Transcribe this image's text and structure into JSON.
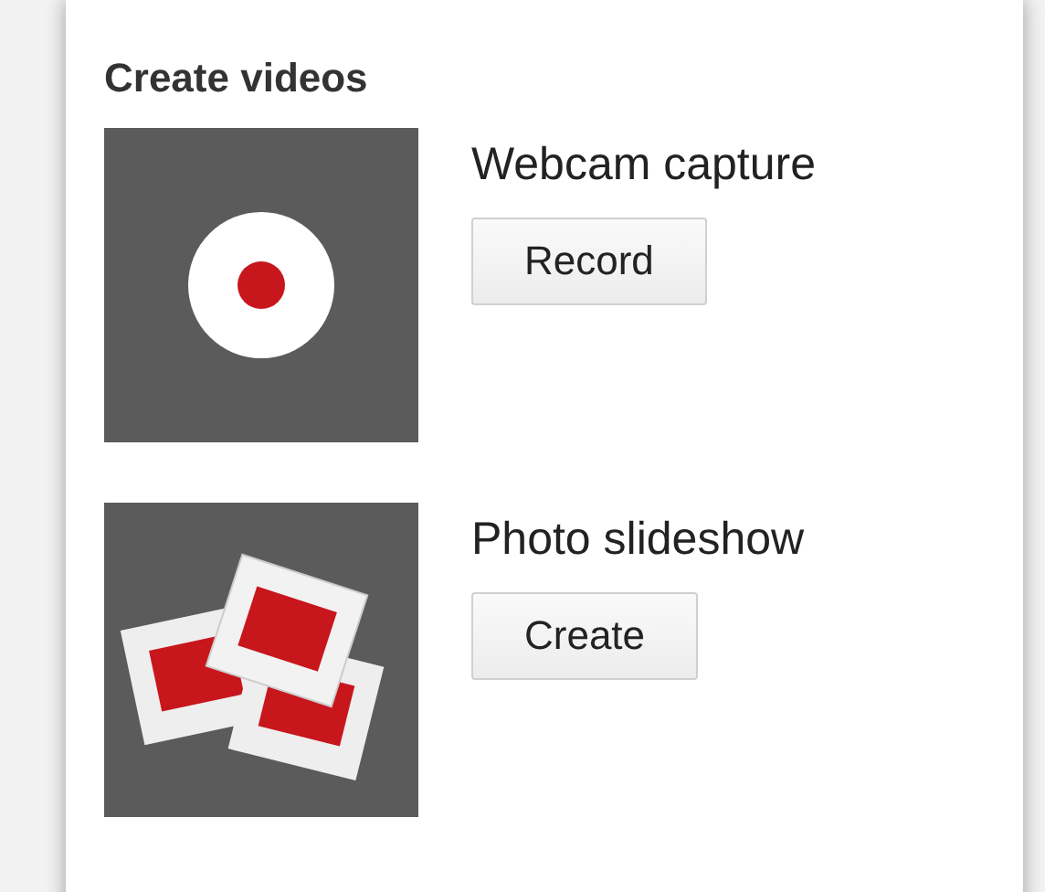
{
  "title": "Create videos",
  "items": [
    {
      "kind": "webcam",
      "label": "Webcam capture",
      "button": "Record"
    },
    {
      "kind": "slideshow",
      "label": "Photo slideshow",
      "button": "Create"
    }
  ]
}
